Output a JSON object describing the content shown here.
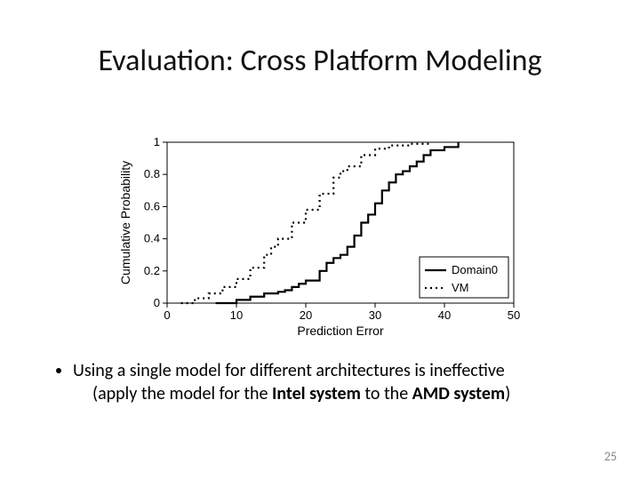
{
  "title": "Evaluation: Cross Platform Modeling",
  "bullet": {
    "line1_pre": "Using a single model for different architectures is ",
    "line1_em": "ineffective",
    "line2_pre": "(apply the model for the ",
    "line2_b1": "Intel system",
    "line2_mid": " to the ",
    "line2_b2": "AMD system",
    "line2_post": ")"
  },
  "pagenum": "25",
  "chart_data": {
    "type": "line",
    "xlabel": "Prediction Error",
    "ylabel": "Cumulative Probability",
    "xlim": [
      0,
      50
    ],
    "ylim": [
      0,
      1
    ],
    "xticks": [
      0,
      10,
      20,
      30,
      40,
      50
    ],
    "yticks": [
      0,
      0.2,
      0.4,
      0.6,
      0.8,
      1
    ],
    "legend": [
      "Domain0",
      "VM"
    ],
    "legend_pos": "right",
    "series": [
      {
        "name": "Domain0",
        "style": "solid",
        "x": [
          7,
          10,
          12,
          14,
          16,
          17,
          18,
          19,
          20,
          22,
          23,
          24,
          25,
          26,
          27,
          28,
          29,
          30,
          31,
          32,
          33,
          34,
          35,
          36,
          37,
          38,
          40,
          42
        ],
        "y": [
          0.0,
          0.02,
          0.04,
          0.06,
          0.07,
          0.08,
          0.1,
          0.12,
          0.14,
          0.2,
          0.25,
          0.28,
          0.3,
          0.35,
          0.42,
          0.5,
          0.55,
          0.62,
          0.7,
          0.75,
          0.8,
          0.82,
          0.85,
          0.88,
          0.92,
          0.95,
          0.97,
          1.0
        ]
      },
      {
        "name": "VM",
        "style": "dotted",
        "x": [
          2,
          4,
          6,
          8,
          10,
          12,
          14,
          15,
          16,
          18,
          20,
          22,
          24,
          25,
          26,
          28,
          30,
          32,
          35,
          38
        ],
        "y": [
          0.0,
          0.03,
          0.06,
          0.1,
          0.15,
          0.22,
          0.3,
          0.35,
          0.4,
          0.5,
          0.58,
          0.68,
          0.78,
          0.82,
          0.85,
          0.92,
          0.96,
          0.98,
          0.99,
          1.0
        ]
      }
    ]
  }
}
